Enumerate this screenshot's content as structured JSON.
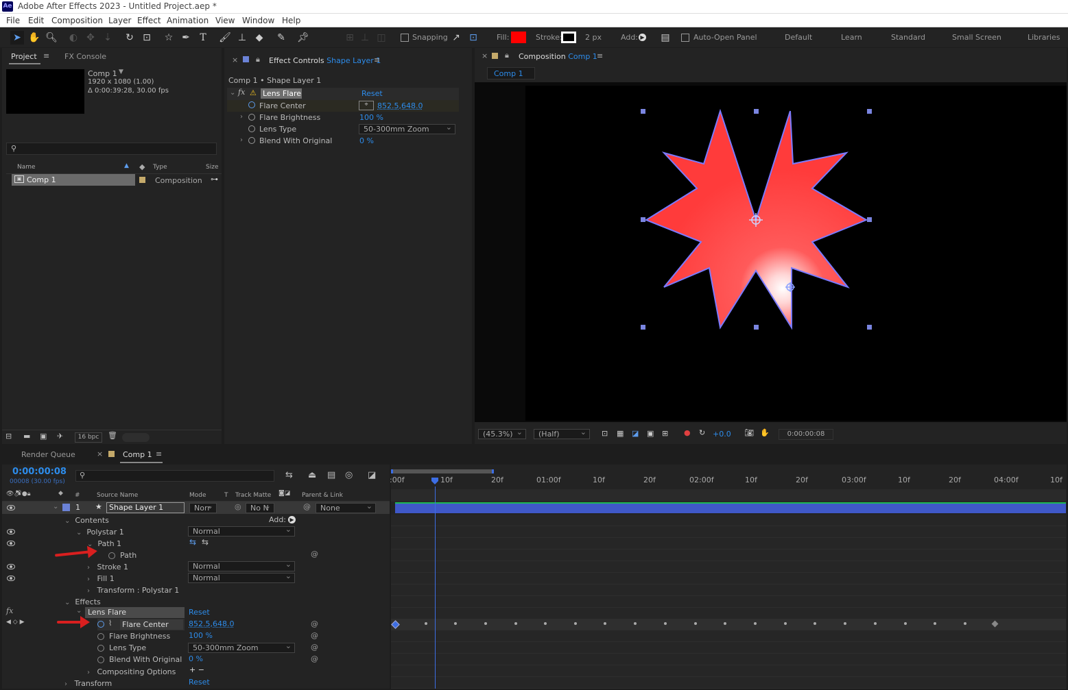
{
  "app": {
    "logo": "Ae",
    "title": "Adobe After Effects 2023 - Untitled Project.aep *"
  },
  "menu": [
    "File",
    "Edit",
    "Composition",
    "Layer",
    "Effect",
    "Animation",
    "View",
    "Window",
    "Help"
  ],
  "toolbar": {
    "snapping": "Snapping",
    "fill": "Fill:",
    "stroke": "Stroke:",
    "stroke_width": "2 px",
    "add": "Add:",
    "auto_open": "Auto-Open Panel",
    "fill_color": "#ff0000",
    "workspaces": [
      "Default",
      "Learn",
      "Standard",
      "Small Screen",
      "Libraries"
    ]
  },
  "project": {
    "tab": "Project",
    "tab2": "FX Console",
    "comp_name": "Comp 1",
    "comp_res": "1920 x 1080 (1.00)",
    "comp_dur": "Δ 0:00:39:28, 30.00 fps",
    "col_name": "Name",
    "col_type": "Type",
    "col_size": "Size",
    "item_name": "Comp 1",
    "item_type": "Composition",
    "bpc": "16 bpc"
  },
  "effect_controls": {
    "tab_prefix": "Effect Controls",
    "tab_layer": "Shape Layer 1",
    "breadcrumb": "Comp 1 • Shape Layer 1",
    "effect": "Lens Flare",
    "reset": "Reset",
    "props": [
      {
        "name": "Flare Center",
        "value": "852.5,648.0"
      },
      {
        "name": "Flare Brightness",
        "value": "100 %"
      },
      {
        "name": "Lens Type",
        "value": "50-300mm Zoom"
      },
      {
        "name": "Blend With Original",
        "value": "0 %"
      }
    ]
  },
  "composition": {
    "tab_prefix": "Composition",
    "tab_comp": "Comp 1",
    "subtab": "Comp 1",
    "zoom": "(45.3%)",
    "resolution": "(Half)",
    "exposure": "+0.0",
    "timecode": "0:00:00:08"
  },
  "timeline": {
    "render_queue": "Render Queue",
    "tab": "Comp 1",
    "timecode": "0:00:00:08",
    "frames": "00008 (30.00 fps)",
    "col_source": "Source Name",
    "col_mode": "Mode",
    "col_t": "T",
    "col_matte": "Track Matte",
    "col_parent": "Parent & Link",
    "layer_num": "1",
    "layer_name": "Shape Layer 1",
    "layer_mode": "Norr",
    "layer_matte": "No N",
    "layer_parent": "None",
    "ruler": [
      ":00f",
      "10f",
      "20f",
      "01:00f",
      "10f",
      "20f",
      "02:00f",
      "10f",
      "20f",
      "03:00f",
      "10f",
      "20f",
      "04:00f",
      "10f"
    ],
    "rows": {
      "contents": "Contents",
      "add": "Add:",
      "polystar": "Polystar 1",
      "path1": "Path 1",
      "path": "Path",
      "stroke1": "Stroke 1",
      "fill1": "Fill 1",
      "transform_poly": "Transform : Polystar 1",
      "effects": "Effects",
      "lens_flare": "Lens Flare",
      "reset": "Reset",
      "flare_center": "Flare Center",
      "flare_center_val": "852.5,648.0",
      "flare_brightness": "Flare Brightness",
      "flare_brightness_val": "100 %",
      "lens_type": "Lens Type",
      "lens_type_val": "50-300mm Zoom",
      "blend": "Blend With Original",
      "blend_val": "0 %",
      "compositing": "Compositing Options",
      "transform": "Transform",
      "transform_reset": "Reset",
      "normal": "Normal"
    }
  }
}
